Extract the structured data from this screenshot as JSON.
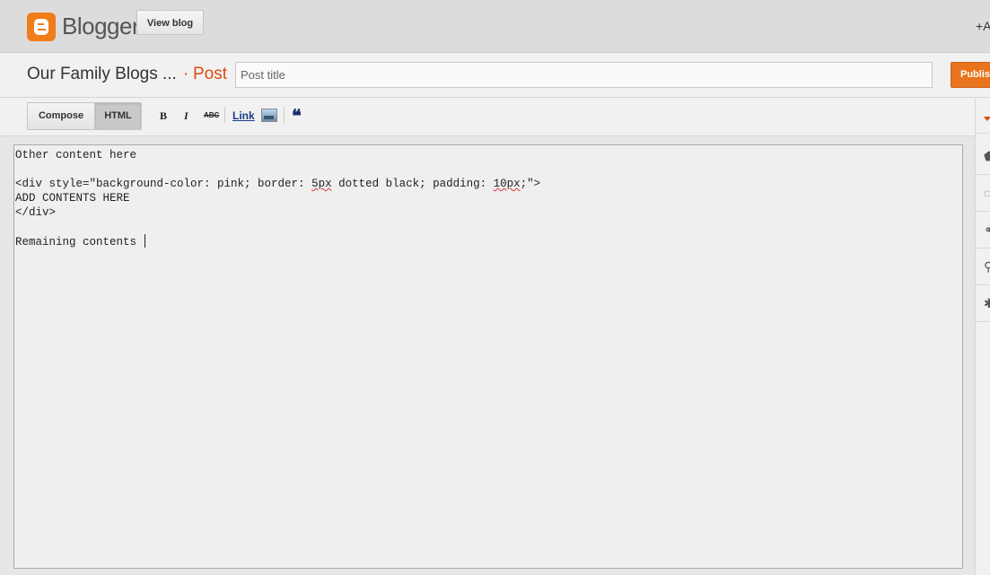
{
  "app": {
    "brand": "Blogger",
    "view_blog_label": "View blog",
    "account_short": "+A"
  },
  "titlebar": {
    "blog_name": "Our Family Blogs ...",
    "separator": "·",
    "post_label": "Post",
    "post_title_placeholder": "Post title",
    "post_title_value": "",
    "publish_label": "Publis"
  },
  "toolbar": {
    "compose_label": "Compose",
    "html_label": "HTML",
    "active_mode": "HTML",
    "bold_label": "B",
    "italic_label": "I",
    "strike_label": "ABC",
    "link_label": "Link",
    "quote_label": "❝"
  },
  "editor": {
    "lines": [
      "Other content here",
      "",
      "<div style=\"background-color: pink; border: 5px dotted black; padding: 10px;\">",
      "ADD CONTENTS HERE",
      "</div>",
      "",
      "Remaining contents "
    ],
    "line3_parts": {
      "a": "<div style=\"background-color: pink; border: ",
      "b": "5px",
      "c": " dotted black; padding: ",
      "d": "10px",
      "e": ";\">"
    }
  },
  "sidebar": {
    "icons": [
      "collapse-arrow-icon",
      "label-tag-icon",
      "schedule-clock-icon",
      "permalink-icon",
      "location-pin-icon",
      "options-gear-icon"
    ],
    "glyphs": [
      "",
      "⬟",
      "◌",
      "⚭",
      "⚲",
      "✱"
    ]
  },
  "colors": {
    "brand_orange": "#f07c1a",
    "post_accent": "#dd4b0f",
    "publish_button": "#e8741d"
  }
}
